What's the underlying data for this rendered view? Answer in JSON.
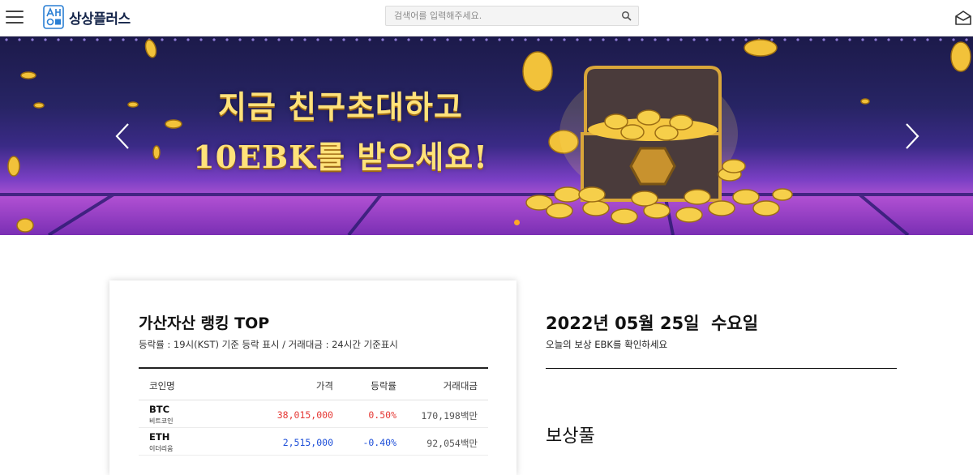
{
  "header": {
    "logo_text": "상상플러스",
    "search_placeholder": "검색어를 입력해주세요."
  },
  "banner": {
    "line1": "지금 친구초대하고",
    "line2": "10EBK를 받으세요!",
    "colors": {
      "text": "#ffe27a",
      "indicator": "#ffa726"
    }
  },
  "ranking": {
    "title": "가산자산 랭킹 TOP",
    "subtitle": "등락률 : 19시(KST) 기준 등락 표시 / 거래대금 : 24시간 기준표시",
    "columns": {
      "name": "코인명",
      "price": "가격",
      "change": "등락률",
      "volume": "거래대금"
    },
    "rows": [
      {
        "symbol": "BTC",
        "name": "비트코인",
        "price": "38,015,000",
        "change": "0.50%",
        "volume": "170,198백만",
        "color": "#e53935"
      },
      {
        "symbol": "ETH",
        "name": "이더리움",
        "price": "2,515,000",
        "change": "-0.40%",
        "volume": "92,054백만",
        "color": "#1e4fd8"
      }
    ]
  },
  "today": {
    "date": "2022년 05월 25일  수요일",
    "subtitle": "오늘의 보상 EBK를 확인하세요",
    "pool_title": "보상풀"
  }
}
